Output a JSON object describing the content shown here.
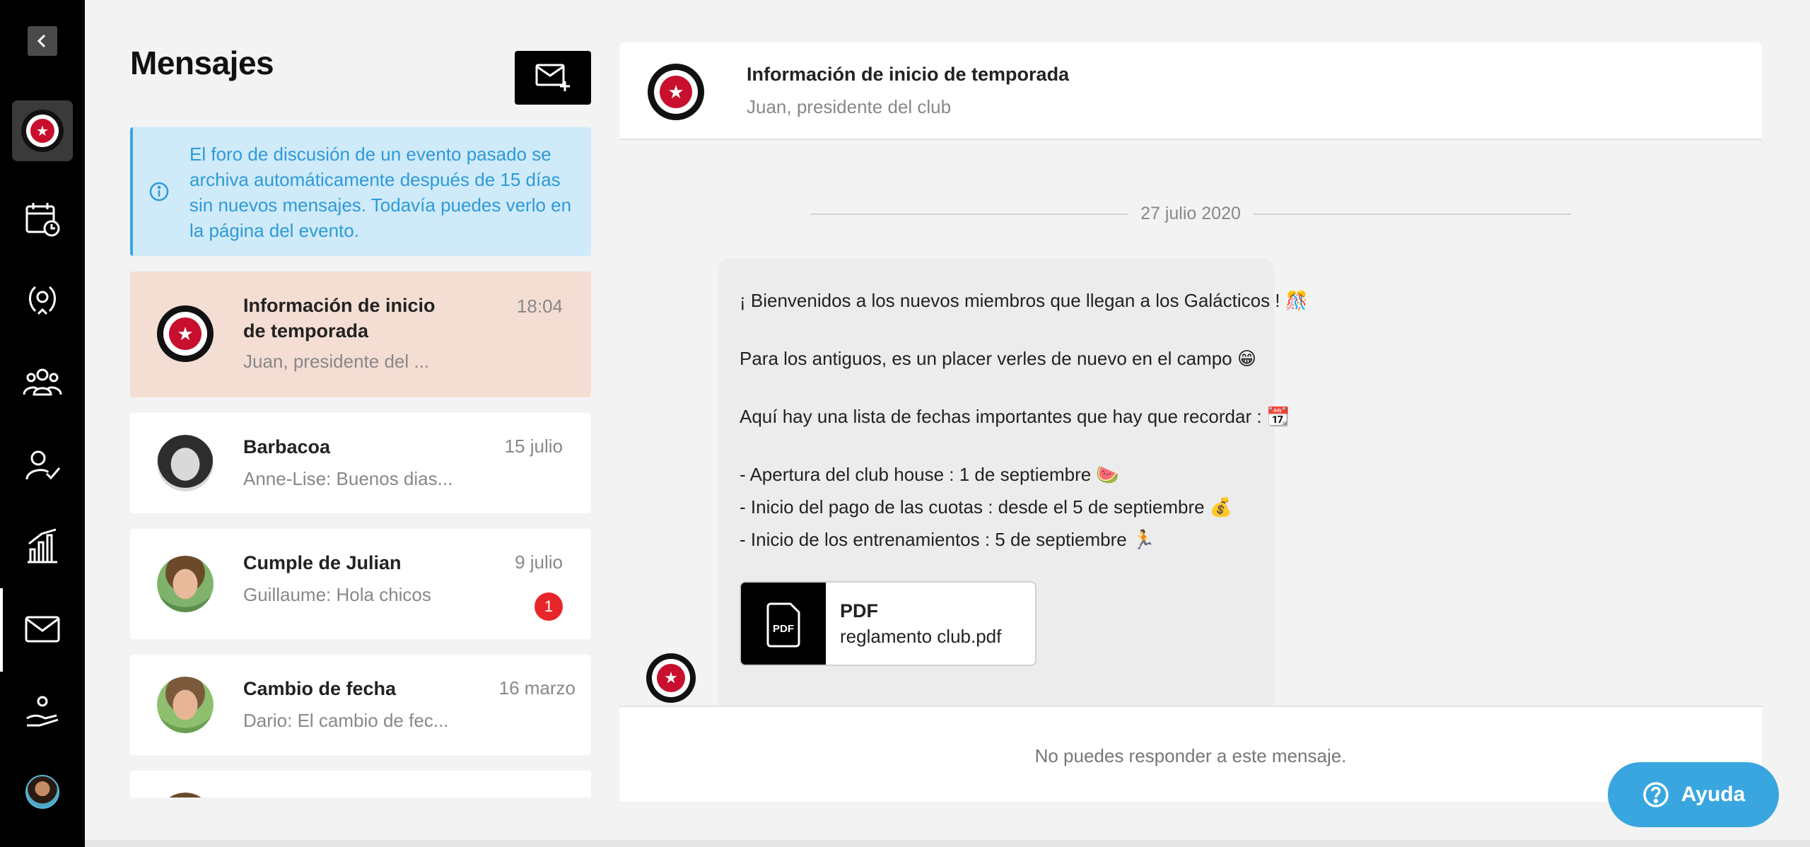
{
  "sidebar": {
    "items": [
      {
        "name": "back",
        "icon": "chevron-left-icon"
      },
      {
        "name": "club",
        "icon": "club-logo"
      },
      {
        "name": "calendar",
        "icon": "calendar-clock-icon"
      },
      {
        "name": "achievements",
        "icon": "laurel-icon"
      },
      {
        "name": "members",
        "icon": "group-icon"
      },
      {
        "name": "attendance",
        "icon": "user-check-icon"
      },
      {
        "name": "stats",
        "icon": "bar-chart-icon"
      },
      {
        "name": "messages",
        "icon": "mail-icon",
        "active": true
      },
      {
        "name": "volunteers",
        "icon": "hand-heart-icon"
      },
      {
        "name": "profile",
        "icon": "avatar"
      }
    ]
  },
  "messages": {
    "title": "Mensajes",
    "info": "El foro de discusión de un evento pasado se archiva automáticamente después de 15 días sin nuevos mensajes. Todavía puedes verlo en la página del evento.",
    "conversations": [
      {
        "title_line1": "Información de inicio",
        "title_line2": "de temporada",
        "preview": "Juan, presidente del ...",
        "time": "18:04",
        "active": true
      },
      {
        "title": "Barbacoa",
        "preview": "Anne-Lise: Buenos dias...",
        "time": "15 julio"
      },
      {
        "title": "Cumple de Julian",
        "preview": "Guillaume: Hola chicos",
        "time": "9 julio",
        "badge": "1"
      },
      {
        "title": "Cambio de fecha",
        "preview": "Dario: El cambio de fec...",
        "time": "16 marzo"
      }
    ]
  },
  "detail": {
    "title": "Información de inicio de temporada",
    "subtitle": "Juan, presidente del club",
    "date": "27 julio 2020",
    "message": {
      "line1": "¡ Bienvenidos a los nuevos miembros que llegan a los Galácticos ! 🎊",
      "line2": "Para los antiguos, es un placer verles de nuevo en el campo 😁",
      "line3": "Aquí hay una lista de fechas importantes que hay que recordar : 📆",
      "line4": "- Apertura del club house : 1 de septiembre 🍉",
      "line5": "- Inicio del pago de las cuotas : desde el 5 de septiembre 💰",
      "line6": "- Inicio de los entrenamientos : 5 de septiembre 🏃"
    },
    "attachment": {
      "kind": "PDF",
      "filename": "reglamento club.pdf",
      "icon_text": "PDF"
    },
    "footer": "No puedes responder a este mensaje."
  },
  "help": {
    "label": "Ayuda"
  },
  "colors": {
    "accent": "#3aa6df",
    "active_conv": "#f4ddd3",
    "badge": "#e8262a",
    "club_red": "#c8102e"
  }
}
